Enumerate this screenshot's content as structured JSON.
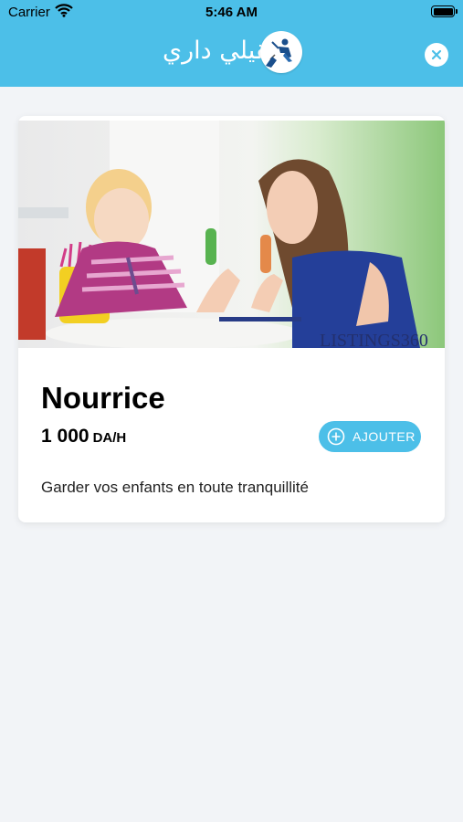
{
  "status_bar": {
    "carrier": "Carrier",
    "time": "5:46 AM"
  },
  "header": {
    "brand_text": "نقيلي داري",
    "background_color": "#4cbfe8"
  },
  "service": {
    "title": "Nourrice",
    "price_value": "1 000",
    "price_unit": "DA/H",
    "add_label": "AJOUTER",
    "description": "Garder vos enfants en toute tranquillité",
    "image_watermark": "LISTINGS360"
  },
  "icons": {
    "wifi": "wifi-icon",
    "battery": "battery-icon",
    "logo": "cleaning-logo-icon",
    "close": "close-icon",
    "add": "plus-circle-icon"
  }
}
